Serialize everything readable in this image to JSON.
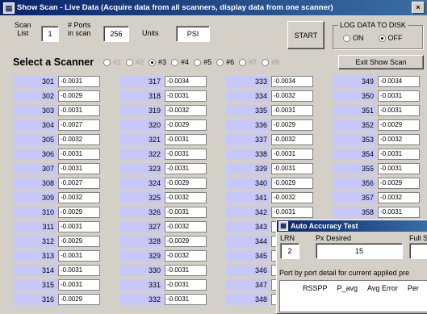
{
  "window": {
    "title": "Show Scan - Live Data  (Acquire data from all scanners, display data from  one scanner)",
    "close_glyph": "×",
    "icon_glyph": "▤"
  },
  "controls": {
    "scan_list_label": "Scan\nList",
    "scan_list_value": "1",
    "ports_label": "# Ports\nin scan",
    "ports_value": "256",
    "units_label": "Units",
    "units_value": "PSI",
    "start_label": "START",
    "log_group_label": "LOG DATA TO DISK",
    "log_on_label": "ON",
    "log_off_label": "OFF",
    "log_selected": "OFF",
    "exit_label": "Exit Show Scan"
  },
  "scanner_select": {
    "label": "Select a Scanner",
    "options": [
      {
        "label": "#1",
        "enabled": false,
        "selected": false
      },
      {
        "label": "#2",
        "enabled": false,
        "selected": false
      },
      {
        "label": "#3",
        "enabled": true,
        "selected": true
      },
      {
        "label": "#4",
        "enabled": true,
        "selected": false
      },
      {
        "label": "#5",
        "enabled": true,
        "selected": false
      },
      {
        "label": "#6",
        "enabled": true,
        "selected": false
      },
      {
        "label": "#7",
        "enabled": false,
        "selected": false
      },
      {
        "label": "#8",
        "enabled": false,
        "selected": false
      }
    ]
  },
  "ports": [
    [
      [
        "301",
        "-0.0031"
      ],
      [
        "302",
        "-0.0029"
      ],
      [
        "303",
        "-0.0031"
      ],
      [
        "304",
        "-0.0027"
      ],
      [
        "305",
        "-0.0032"
      ],
      [
        "306",
        "-0.0031"
      ],
      [
        "307",
        "-0.0031"
      ],
      [
        "308",
        "-0.0027"
      ],
      [
        "309",
        "-0.0032"
      ],
      [
        "310",
        "-0.0029"
      ],
      [
        "311",
        "-0.0031"
      ],
      [
        "312",
        "-0.0029"
      ],
      [
        "313",
        "-0.0031"
      ],
      [
        "314",
        "-0.0031"
      ],
      [
        "315",
        "-0.0031"
      ],
      [
        "316",
        "-0.0029"
      ]
    ],
    [
      [
        "317",
        "-0.0034"
      ],
      [
        "318",
        "-0.0031"
      ],
      [
        "319",
        "-0.0032"
      ],
      [
        "320",
        "-0.0029"
      ],
      [
        "321",
        "-0.0031"
      ],
      [
        "322",
        "-0.0031"
      ],
      [
        "323",
        "-0.0031"
      ],
      [
        "324",
        "-0.0029"
      ],
      [
        "325",
        "-0.0032"
      ],
      [
        "326",
        "-0.0031"
      ],
      [
        "327",
        "-0.0032"
      ],
      [
        "328",
        "-0.0029"
      ],
      [
        "329",
        "-0.0032"
      ],
      [
        "330",
        "-0.0031"
      ],
      [
        "331",
        "-0.0031"
      ],
      [
        "332",
        "-0.0031"
      ]
    ],
    [
      [
        "333",
        "-0.0034"
      ],
      [
        "334",
        "-0.0032"
      ],
      [
        "335",
        "-0.0031"
      ],
      [
        "336",
        "-0.0029"
      ],
      [
        "337",
        "-0.0032"
      ],
      [
        "338",
        "-0.0031"
      ],
      [
        "339",
        "-0.0031"
      ],
      [
        "340",
        "-0.0029"
      ],
      [
        "341",
        "-0.0032"
      ],
      [
        "342",
        "-0.0031"
      ],
      [
        "343",
        ""
      ],
      [
        "344",
        ""
      ],
      [
        "345",
        ""
      ],
      [
        "346",
        ""
      ],
      [
        "347",
        ""
      ],
      [
        "348",
        ""
      ]
    ],
    [
      [
        "349",
        "-0.0034"
      ],
      [
        "350",
        "-0.0031"
      ],
      [
        "351",
        "-0.0031"
      ],
      [
        "352",
        "-0.0029"
      ],
      [
        "353",
        "-0.0032"
      ],
      [
        "354",
        "-0.0031"
      ],
      [
        "355",
        "-0.0031"
      ],
      [
        "356",
        "-0.0029"
      ],
      [
        "357",
        "-0.0032"
      ],
      [
        "358",
        "-0.0031"
      ]
    ]
  ],
  "popup": {
    "title": "Auto Accuracy Test",
    "icon_glyph": "▦",
    "lrn_label": "LRN",
    "lrn_value": "2",
    "px_desired_label": "Px Desired",
    "px_desired_value": "15",
    "full_label": "Full S",
    "detail_text": "Port by port detail for current applied pre",
    "col_headers": [
      "RSSPP",
      "P_avg",
      "Avg Error",
      "Per"
    ]
  }
}
